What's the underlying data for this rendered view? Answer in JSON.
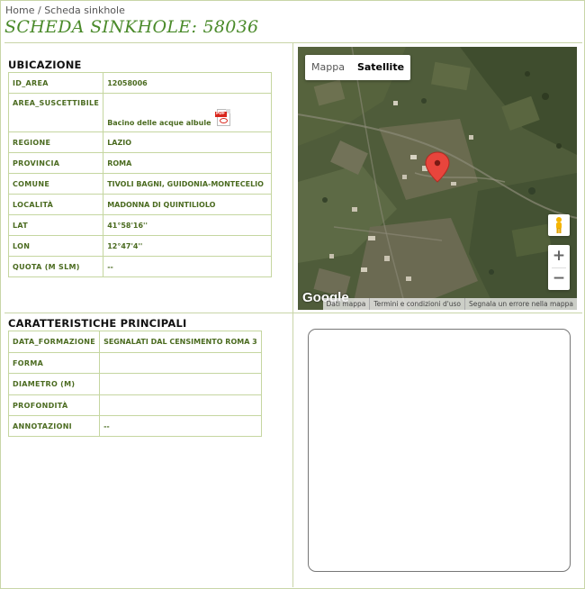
{
  "breadcrumb": {
    "home": "Home",
    "separator": "/",
    "current": "Scheda sinkhole"
  },
  "page_title": "SCHEDA SINKHOLE: 58036",
  "ubicazione": {
    "heading": "UBICAZIONE",
    "rows": [
      {
        "key": "ID_AREA",
        "value": "12058006"
      },
      {
        "key": "AREA_SUSCETTIBILE",
        "value": "Bacino delle acque albule"
      },
      {
        "key": "REGIONE",
        "value": "LAZIO"
      },
      {
        "key": "PROVINCIA",
        "value": "ROMA"
      },
      {
        "key": "COMUNE",
        "value": "TIVOLI BAGNI, GUIDONIA-MONTECELIO"
      },
      {
        "key": "LOCALITÀ",
        "value": "MADONNA DI QUINTILIOLO"
      },
      {
        "key": "LAT",
        "value": "41°58'16''"
      },
      {
        "key": "LON",
        "value": "12°47'4''"
      },
      {
        "key": "QUOTA (M SLM)",
        "value": "--"
      }
    ]
  },
  "caratteristiche": {
    "heading": "CARATTERISTICHE PRINCIPALI",
    "rows": [
      {
        "key": "DATA_FORMAZIONE",
        "value": "SEGNALATI DAL CENSIMENTO ROMA 3"
      },
      {
        "key": "FORMA",
        "value": ""
      },
      {
        "key": "DIAMETRO (M)",
        "value": ""
      },
      {
        "key": "PROFONDITÀ",
        "value": ""
      },
      {
        "key": "ANNOTAZIONI",
        "value": "--"
      }
    ]
  },
  "map": {
    "type_map": "Mappa",
    "type_satellite": "Satellite",
    "active_type": "Satellite",
    "zoom_in": "+",
    "zoom_out": "−",
    "logo": "Google",
    "attribution": {
      "data": "Dati mappa",
      "terms": "Termini e condizioni d'uso",
      "report": "Segnala un errore nella mappa"
    },
    "marker_color": "#e8453c"
  },
  "icons": {
    "pdf": "pdf-file-icon",
    "pegman": "street-view-pegman-icon",
    "marker": "map-marker-icon"
  },
  "colors": {
    "title_green": "#4a8a2a",
    "table_text": "#4b6b20",
    "border": "#c5d6a0"
  }
}
